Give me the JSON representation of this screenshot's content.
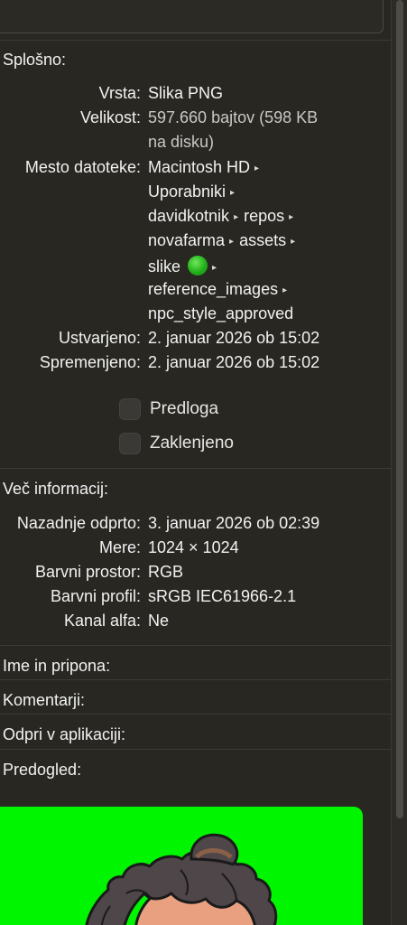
{
  "sections": {
    "general": "Splošno:",
    "more_info": "Več informacij:",
    "name_ext": "Ime in pripona:",
    "comments": "Komentarji:",
    "open_with": "Odpri v aplikaciji:",
    "preview": "Predogled:"
  },
  "general": {
    "kind_label": "Vrsta:",
    "kind_value": "Slika PNG",
    "size_label": "Velikost:",
    "size_value_1": "597.660 bajtov (598 KB",
    "size_value_2": "na disku)",
    "where_label": "Mesto datoteke:",
    "path": {
      "p1": "Macintosh HD",
      "p2": "Uporabniki",
      "p3": "davidkotnik",
      "p4": "repos",
      "p5": "novafarma",
      "p6": "assets",
      "p7": "slike",
      "p8": "reference_images",
      "p9": "npc_style_approved",
      "arrow": "▸"
    },
    "created_label": "Ustvarjeno:",
    "created_value": "2. januar 2026 ob 15:02",
    "modified_label": "Spremenjeno:",
    "modified_value": "2. januar 2026 ob 15:02",
    "stationery_label": "Predloga",
    "locked_label": "Zaklenjeno"
  },
  "more_info": {
    "last_opened_label": "Nazadnje odprto:",
    "last_opened_value": "3. januar 2026 ob 02:39",
    "dimensions_label": "Mere:",
    "dimensions_value": "1024 × 1024",
    "color_space_label": "Barvni prostor:",
    "color_space_value": "RGB",
    "color_profile_label": "Barvni profil:",
    "color_profile_value": "sRGB IEC61966-2.1",
    "alpha_label": "Kanal alfa:",
    "alpha_value": "Ne"
  },
  "colors": {
    "background": "#282722",
    "tag_green": "#21b11a",
    "preview_bg": "#00f600"
  },
  "preview": {
    "stationery_checked": false,
    "locked_checked": false
  }
}
